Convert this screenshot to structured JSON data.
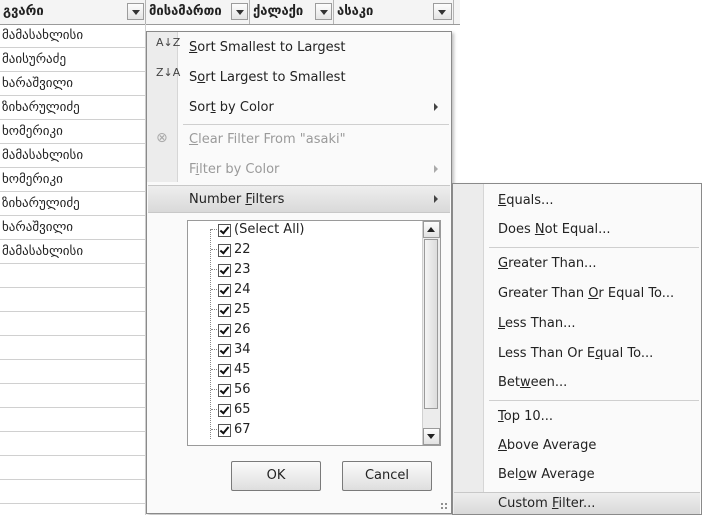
{
  "sheet": {
    "headers": [
      "გვარი",
      "მისამართი",
      "ქალაქი",
      "ასაკი"
    ],
    "rows": [
      "მამასახლისი",
      "მაისურაძე",
      "ხარაშვილი",
      "ზიხარულიძე",
      "ხომერიკი",
      "მამასახლისი",
      "ხომერიკი",
      "ზიხარულიძე",
      "ხარაშვილი",
      "მამასახლისი"
    ]
  },
  "menu": {
    "sort_asc": {
      "icon": "A↓Z",
      "pre": "",
      "key": "S",
      "post": "ort Smallest to Largest"
    },
    "sort_desc": {
      "icon": "Z↓A",
      "pre": "S",
      "key": "o",
      "post": "rt Largest to Smallest"
    },
    "sort_color": {
      "pre": "Sor",
      "key": "t",
      "post": " by Color"
    },
    "clear_filter": {
      "pre": "",
      "key": "C",
      "post": "lear Filter From \"asaki\""
    },
    "filter_color": {
      "pre": "F",
      "key": "i",
      "post": "lter by Color"
    },
    "number_filters": {
      "pre": "Number ",
      "key": "F",
      "post": "ilters"
    },
    "checklist": [
      "(Select All)",
      "22",
      "23",
      "24",
      "25",
      "26",
      "34",
      "45",
      "56",
      "65",
      "67"
    ],
    "ok_label": "OK",
    "cancel_label": "Cancel"
  },
  "submenu": {
    "equals": {
      "pre": "",
      "key": "E",
      "post": "quals..."
    },
    "not_equal": {
      "pre": "Does ",
      "key": "N",
      "post": "ot Equal..."
    },
    "greater": {
      "pre": "",
      "key": "G",
      "post": "reater Than..."
    },
    "greater_eq": {
      "pre": "Greater Than ",
      "key": "O",
      "post": "r Equal To..."
    },
    "less": {
      "pre": "",
      "key": "L",
      "post": "ess Than..."
    },
    "less_eq": {
      "pre": "Less Than Or E",
      "key": "q",
      "post": "ual To..."
    },
    "between": {
      "pre": "Bet",
      "key": "w",
      "post": "een..."
    },
    "top10": {
      "pre": "",
      "key": "T",
      "post": "op 10..."
    },
    "above_avg": {
      "pre": "",
      "key": "A",
      "post": "bove Average"
    },
    "below_avg": {
      "pre": "Bel",
      "key": "o",
      "post": "w Average"
    },
    "custom": {
      "pre": "Custom ",
      "key": "F",
      "post": "ilter..."
    }
  }
}
